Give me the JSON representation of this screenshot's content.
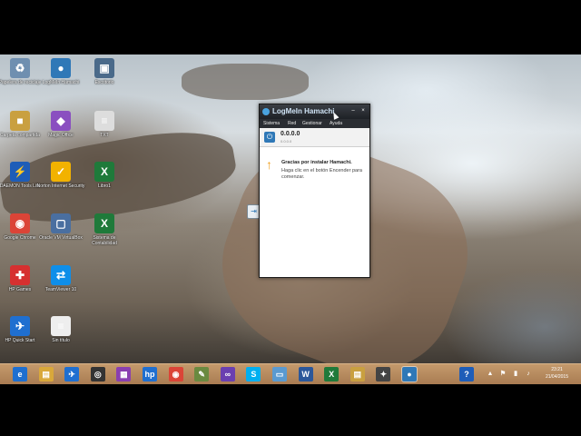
{
  "desktop": {
    "icons": [
      {
        "label": "Papelera de reciclaje",
        "icon": "recycle-bin-icon",
        "color": "#6f8fb0",
        "glyph": "♻"
      },
      {
        "label": "LogMeIn Hamachi",
        "icon": "hamachi-icon",
        "color": "#2f78b7",
        "glyph": "●"
      },
      {
        "label": "Escritorio",
        "icon": "computer-icon",
        "color": "#4a6a8a",
        "glyph": "▣"
      },
      {
        "label": "Carpeta compartida",
        "icon": "folder-icon",
        "color": "#c9a040",
        "glyph": "■"
      },
      {
        "label": "Magic Office",
        "icon": "office-icon",
        "color": "#8a4fc0",
        "glyph": "◆"
      },
      {
        "label": "TXT",
        "icon": "document-icon",
        "color": "#dddddd",
        "glyph": "≡"
      },
      {
        "label": "DAEMON Tools Lite",
        "icon": "daemon-tools-icon",
        "color": "#1e5db8",
        "glyph": "⚡"
      },
      {
        "label": "Norton Internet Security",
        "icon": "norton-icon",
        "color": "#f2b200",
        "glyph": "✓"
      },
      {
        "label": "Libro1",
        "icon": "excel-icon",
        "color": "#1f7a3a",
        "glyph": "X"
      },
      {
        "label": "Google Chrome",
        "icon": "chrome-icon",
        "color": "#db4437",
        "glyph": "◉"
      },
      {
        "label": "Oracle VM VirtualBox",
        "icon": "virtualbox-icon",
        "color": "#4a6fa0",
        "glyph": "▢"
      },
      {
        "label": "Sistema de Contabilidad",
        "icon": "excel-icon",
        "color": "#1f7a3a",
        "glyph": "X"
      },
      {
        "label": "HP Games",
        "icon": "hp-games-icon",
        "color": "#d63030",
        "glyph": "✚"
      },
      {
        "label": "TeamViewer 10",
        "icon": "teamviewer-icon",
        "color": "#0e8ee9",
        "glyph": "⇄"
      },
      {
        "label": "HP Quick Start",
        "icon": "hp-quick-start-icon",
        "color": "#1f6fd0",
        "glyph": "✈"
      },
      {
        "label": "Sin título",
        "icon": "document-icon",
        "color": "#eeeeee",
        "glyph": "≡"
      }
    ]
  },
  "hamachi": {
    "title": "LogMeIn Hamachi",
    "menu": [
      "Sistema",
      "Red",
      "Gestionar",
      "Ayuda"
    ],
    "ip": "0.0.0.0",
    "ip_sub": "0.0.0.0",
    "welcome_title": "Gracias por instalar Hamachi.",
    "welcome_body": "Haga clic en el botón Encender para comenzar."
  },
  "taskbar": {
    "apps": [
      {
        "icon": "internet-explorer-icon",
        "color": "#1e6fd0",
        "glyph": "e"
      },
      {
        "icon": "file-explorer-icon",
        "color": "#d9a83a",
        "glyph": "▤"
      },
      {
        "icon": "hp-quick-start-icon",
        "color": "#1f6fd0",
        "glyph": "✈"
      },
      {
        "icon": "media-icon",
        "color": "#333333",
        "glyph": "◎"
      },
      {
        "icon": "photo-icon",
        "color": "#8a3fb0",
        "glyph": "▦"
      },
      {
        "icon": "hp-icon",
        "color": "#1f6fd0",
        "glyph": "hp"
      },
      {
        "icon": "chrome-icon",
        "color": "#db4437",
        "glyph": "◉"
      },
      {
        "icon": "tools-icon",
        "color": "#6a8a40",
        "glyph": "✎"
      },
      {
        "icon": "visual-studio-icon",
        "color": "#6a3fb0",
        "glyph": "∞"
      },
      {
        "icon": "skype-icon",
        "color": "#00aff0",
        "glyph": "S"
      },
      {
        "icon": "notes-icon",
        "color": "#5a9ad0",
        "glyph": "▭"
      },
      {
        "icon": "word-icon",
        "color": "#2b579a",
        "glyph": "W"
      },
      {
        "icon": "excel-icon",
        "color": "#1f7a3a",
        "glyph": "X"
      },
      {
        "icon": "folder-icon",
        "color": "#c9a040",
        "glyph": "▤"
      },
      {
        "icon": "game-icon",
        "color": "#444444",
        "glyph": "✦"
      },
      {
        "icon": "hamachi-icon",
        "color": "#2f78b7",
        "glyph": "●",
        "active": true
      }
    ],
    "tray": {
      "time": "23:21",
      "date": "21/04/2015"
    }
  }
}
